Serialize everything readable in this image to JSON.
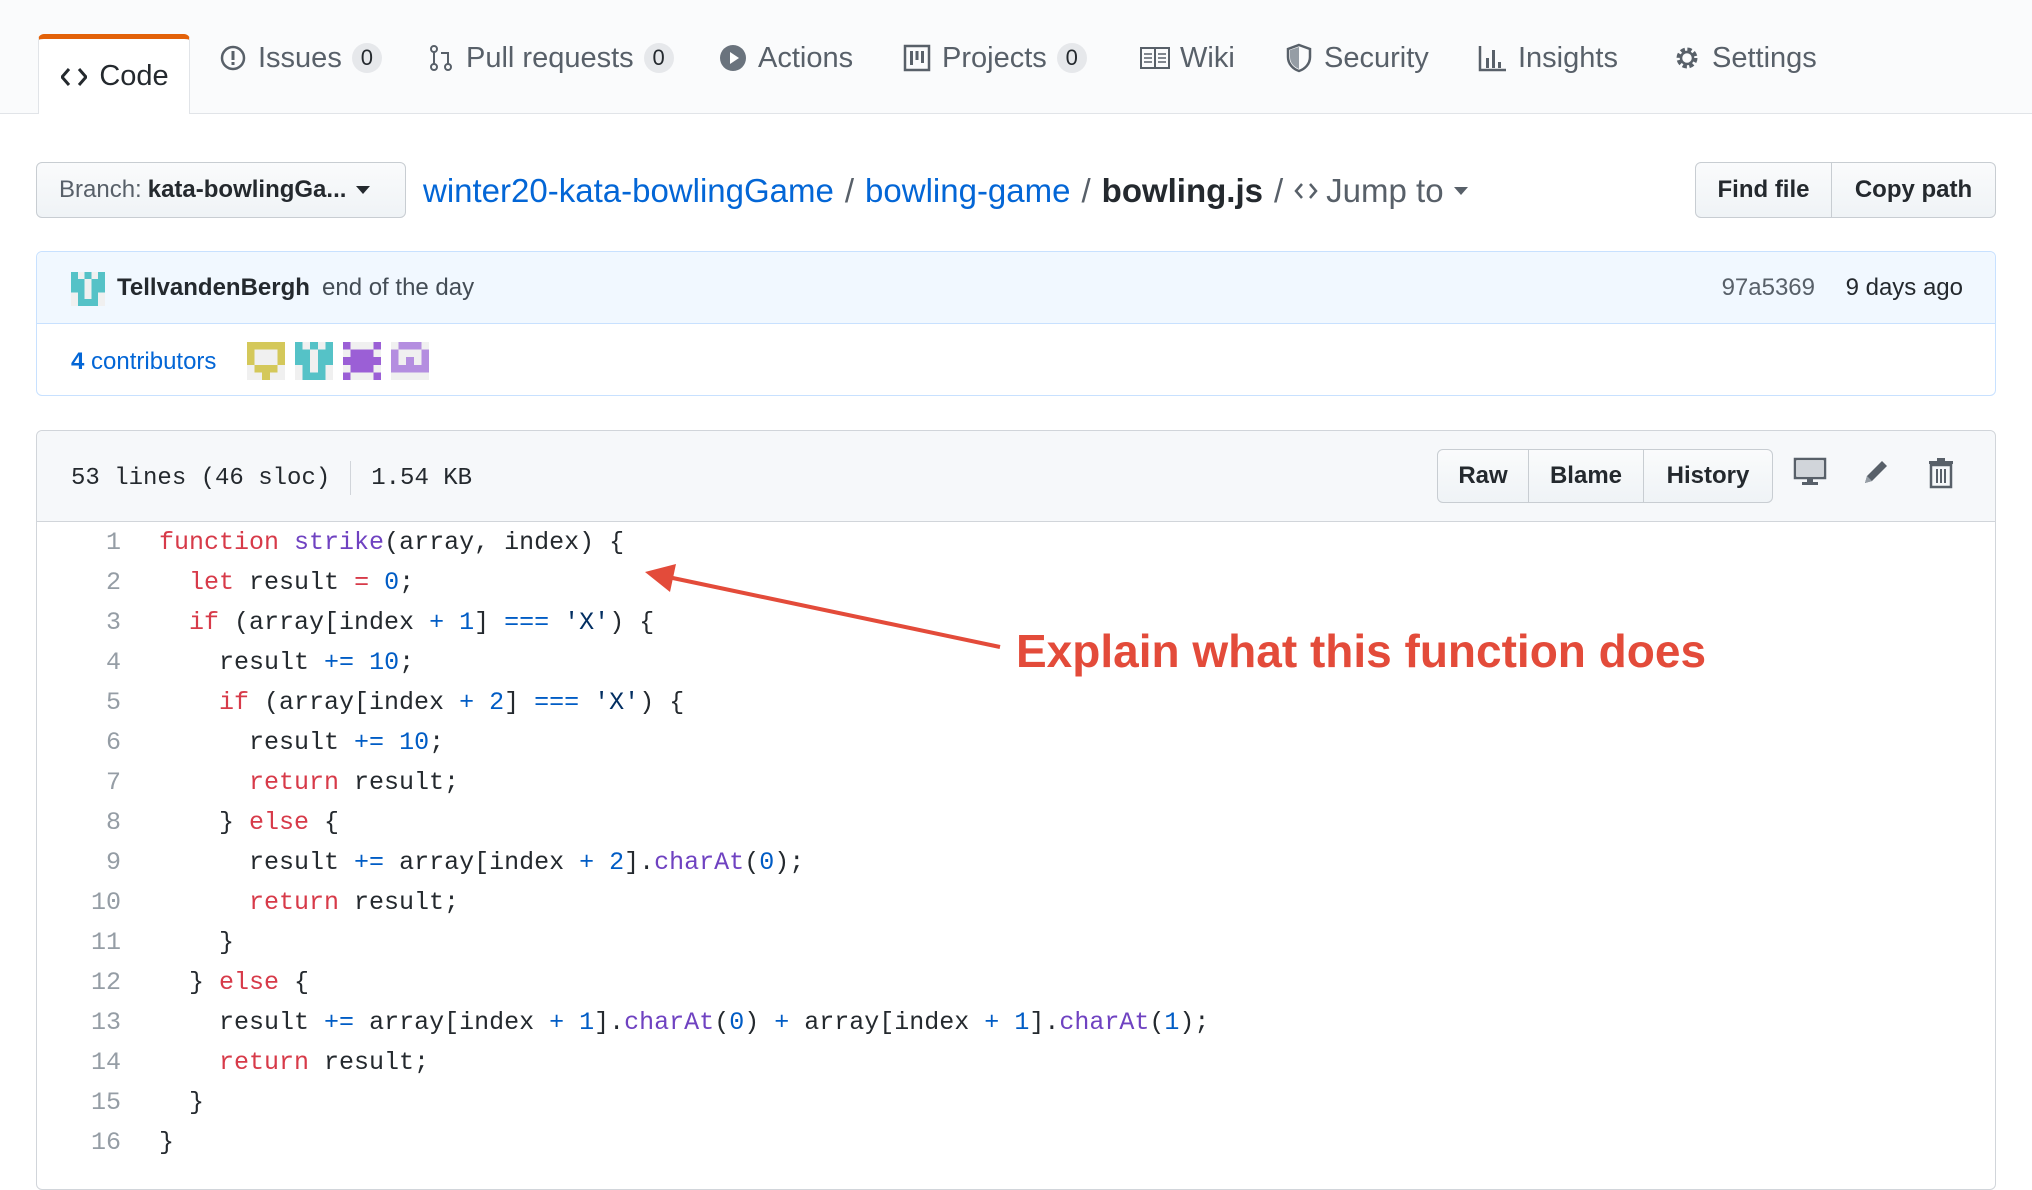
{
  "tabs": [
    {
      "label": "Code",
      "icon": "code-icon",
      "selected": true
    },
    {
      "label": "Issues",
      "icon": "issue-icon",
      "count": "0"
    },
    {
      "label": "Pull requests",
      "icon": "pull-request-icon",
      "count": "0"
    },
    {
      "label": "Actions",
      "icon": "play-icon"
    },
    {
      "label": "Projects",
      "icon": "project-icon",
      "count": "0"
    },
    {
      "label": "Wiki",
      "icon": "book-icon"
    },
    {
      "label": "Security",
      "icon": "shield-icon"
    },
    {
      "label": "Insights",
      "icon": "graph-icon"
    },
    {
      "label": "Settings",
      "icon": "gear-icon"
    }
  ],
  "branch": {
    "label": "Branch:",
    "value": "kata-bowlingGa..."
  },
  "breadcrumb": {
    "repo": "winter20-kata-bowlingGame",
    "folder": "bowling-game",
    "file": "bowling.js",
    "sep": "/",
    "jump": "Jump to"
  },
  "header_buttons": {
    "find_file": "Find file",
    "copy_path": "Copy path"
  },
  "commit": {
    "author": "TellvandenBergh",
    "message": "end of the day",
    "sha": "97a5369",
    "ago": "9 days ago"
  },
  "contributors": {
    "count": "4",
    "label": "contributors"
  },
  "file": {
    "lines_info": "53 lines (46 sloc)",
    "size": "1.54 KB",
    "raw": "Raw",
    "blame": "Blame",
    "history": "History"
  },
  "code_lines": [
    {
      "n": "1"
    },
    {
      "n": "2"
    },
    {
      "n": "3"
    },
    {
      "n": "4"
    },
    {
      "n": "5"
    },
    {
      "n": "6"
    },
    {
      "n": "7"
    },
    {
      "n": "8"
    },
    {
      "n": "9"
    },
    {
      "n": "10"
    },
    {
      "n": "11"
    },
    {
      "n": "12"
    },
    {
      "n": "13"
    },
    {
      "n": "14"
    },
    {
      "n": "15"
    },
    {
      "n": "16"
    }
  ],
  "code_tokens": {
    "l1": [
      "function",
      "strike",
      "(array, index) {"
    ],
    "l2": [
      "let",
      " result ",
      "=",
      " ",
      "0",
      ";"
    ],
    "l3": [
      "if",
      " (array[index ",
      "+",
      " ",
      "1",
      "] ",
      "===",
      " ",
      "'X'",
      ") {"
    ],
    "l4": [
      "result ",
      "+=",
      " ",
      "10",
      ";"
    ],
    "l5": [
      "if",
      " (array[index ",
      "+",
      " ",
      "2",
      "] ",
      "===",
      " ",
      "'X'",
      ") {"
    ],
    "l6": [
      "result ",
      "+=",
      " ",
      "10",
      ";"
    ],
    "l7": [
      "return",
      " result;"
    ],
    "l8": [
      "} ",
      "else",
      " {"
    ],
    "l9": [
      "result ",
      "+=",
      " array[index ",
      "+",
      " ",
      "2",
      "].",
      "charAt",
      "(",
      "0",
      ");"
    ],
    "l10": [
      "return",
      " result;"
    ],
    "l11": [
      "}"
    ],
    "l12": [
      "} ",
      "else",
      " {"
    ],
    "l13": [
      "result ",
      "+=",
      " array[index ",
      "+",
      " ",
      "1",
      "].",
      "charAt",
      "(",
      "0",
      ") ",
      "+",
      " array[index ",
      "+",
      " ",
      "1",
      "].",
      "charAt",
      "(",
      "1",
      ");"
    ],
    "l14": [
      "return",
      " result;"
    ],
    "l15": [
      "}"
    ],
    "l16": [
      "}"
    ]
  },
  "annotation": {
    "text": "Explain what this function does",
    "color": "#e34b3a"
  },
  "colors": {
    "accent": "#e36209",
    "link": "#0366d6",
    "keyword": "#d73a49",
    "function": "#6f42c1",
    "number": "#005cc5"
  }
}
